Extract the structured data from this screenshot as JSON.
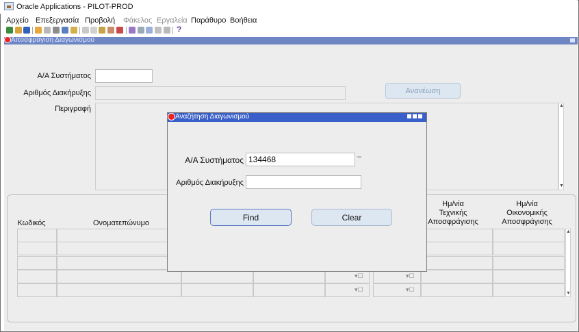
{
  "window": {
    "title": "Oracle Applications - PILOT-PROD"
  },
  "menubar": [
    "Αρχείο",
    "Επεξεργασία",
    "Προβολή",
    "Φάκελος",
    "Εργαλεία",
    "Παράθυρο",
    "Βοήθεια"
  ],
  "menubar_disabled": [
    "Φάκελος",
    "Εργαλεία"
  ],
  "toolbar": {
    "help_glyph": "?"
  },
  "form": {
    "title": "Αποσφράγιση Διαγωνισμού",
    "system_id_label": "Α/Α Συστήματος",
    "system_id_value": "",
    "announcement_label": "Αριθμός Διακήρυξης",
    "announcement_value": "",
    "description_label": "Περιγραφή",
    "refresh_button": "Ανανέωση"
  },
  "grid": {
    "headers": {
      "code": "Κωδικός",
      "name": "Ονοματεπώνυμο",
      "tech_date": [
        "Ημ/νία",
        "Τεχνικής",
        "Αποσφράγισης"
      ],
      "econ_date": [
        "Ημ/νία",
        "Οικονομικής",
        "Αποσφράγισης"
      ]
    }
  },
  "dialog": {
    "title": "Αναζήτηση Διαγωνισμού",
    "system_id_label": "Α/Α Συστήματος",
    "system_id_value": "134468",
    "lov_indicator": "–",
    "announcement_label": "Αριθμός Διακήρυξης",
    "announcement_value": "",
    "find_button": "Find",
    "clear_button": "Clear"
  },
  "colors": {
    "form_title_bar": "#6f86c4",
    "dialog_title_bar": "#3a5fc8",
    "canvas": "#ededed"
  }
}
